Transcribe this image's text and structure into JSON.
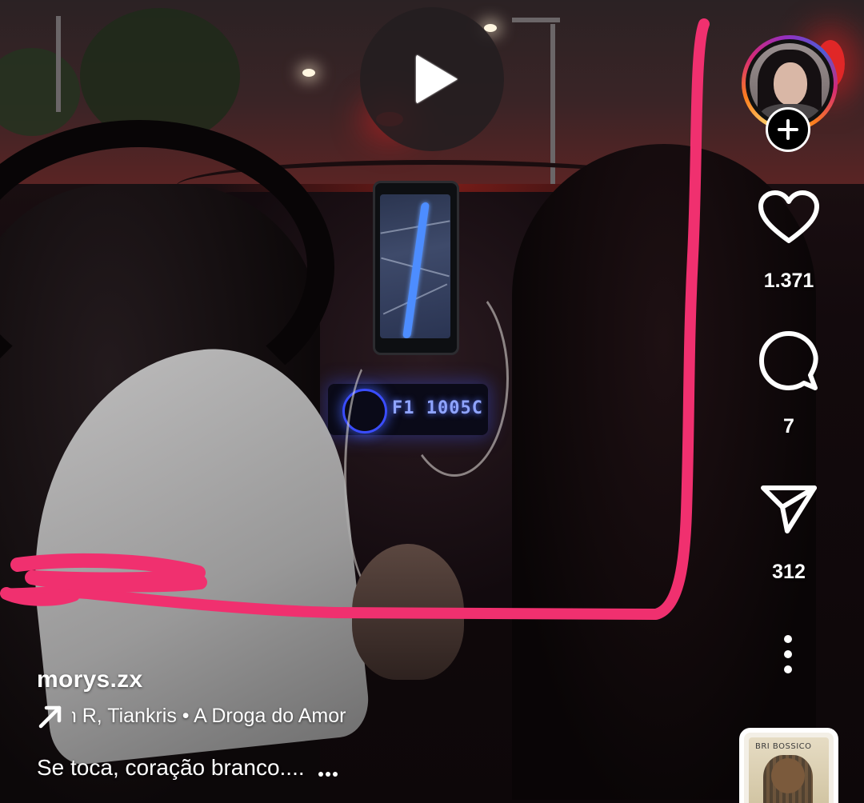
{
  "video": {
    "state": "paused",
    "play_icon": "play-icon"
  },
  "author": {
    "username": "morys.zx",
    "avatar_icon": "profile-avatar",
    "follow_icon": "plus-icon"
  },
  "actions": {
    "likes": {
      "icon": "heart-icon",
      "count": "1.371"
    },
    "comments": {
      "icon": "comment-icon",
      "count": "7"
    },
    "shares": {
      "icon": "send-icon",
      "count": "312"
    },
    "more": {
      "icon": "more-vertical-icon"
    }
  },
  "audio": {
    "icon": "trending-arrow-icon",
    "text": "an R, Tiankris • A Droga do Amor",
    "thumbnail_label": "BRI BOSSICO"
  },
  "caption": {
    "text": "Se toca, coração branco.... "
  },
  "colors": {
    "scribble": "#f0306f",
    "text": "#ffffff"
  },
  "overlays": {
    "screen_text": {
      "radio": "F1 1005C"
    }
  }
}
